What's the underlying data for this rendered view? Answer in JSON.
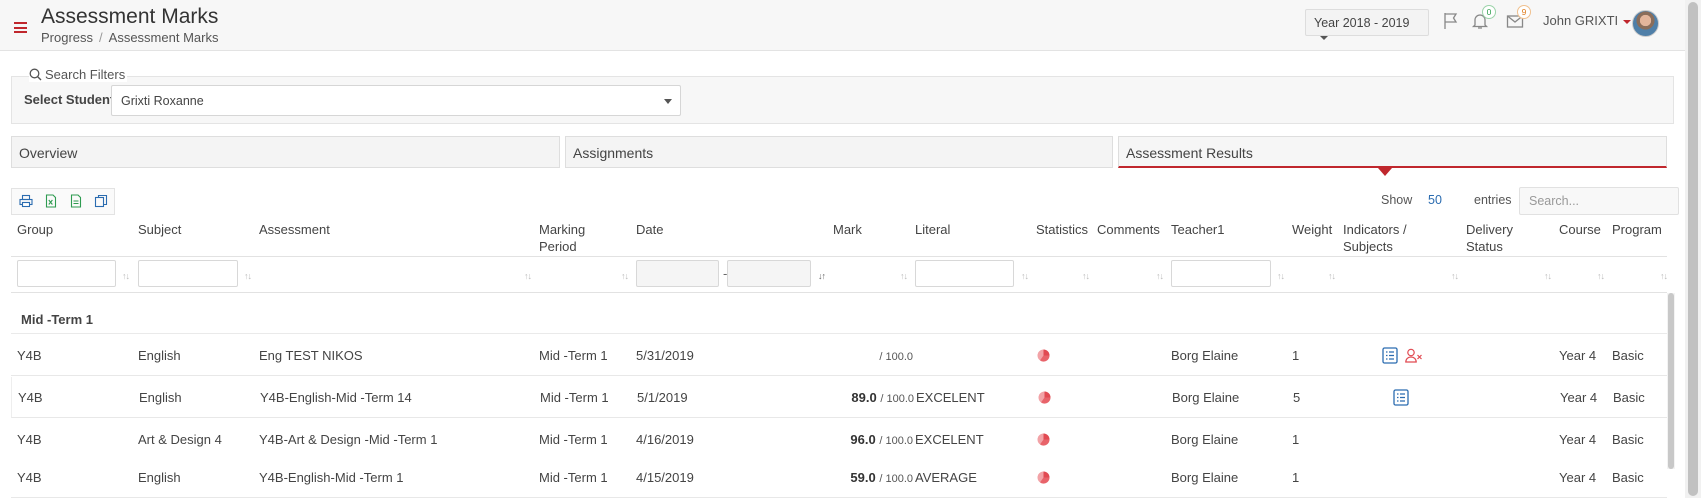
{
  "header": {
    "title": "Assessment Marks",
    "breadcrumb": [
      "Progress",
      "Assessment Marks"
    ],
    "year_selector": "Year 2018 - 2019",
    "notifications_count": "0",
    "messages_count": "9",
    "user_name": "John GRIXTI"
  },
  "filters": {
    "legend": "Search Filters",
    "student_label": "Select Student",
    "student_value": "Grixti Roxanne"
  },
  "tabs": [
    {
      "label": "Overview",
      "active": false
    },
    {
      "label": "Assignments",
      "active": false
    },
    {
      "label": "Assessment Results",
      "active": true
    }
  ],
  "table_controls": {
    "show_label": "Show",
    "show_value": "50",
    "entries_label": "entries",
    "search_placeholder": "Search..."
  },
  "columns": {
    "group": "Group",
    "subject": "Subject",
    "assessment": "Assessment",
    "marking_period_1": "Marking",
    "marking_period_2": "Period",
    "date": "Date",
    "mark": "Mark",
    "literal": "Literal",
    "statistics": "Statistics",
    "comments": "Comments",
    "teacher": "Teacher1",
    "weight": "Weight",
    "indicators_1": "Indicators /",
    "indicators_2": "Subjects",
    "delivery_1": "Delivery",
    "delivery_2": "Status",
    "course": "Course",
    "program": "Program"
  },
  "group_label": "Mid -Term 1",
  "rows": [
    {
      "group": "Y4B",
      "subject": "English",
      "assessment": "Eng TEST NIKOS",
      "period": "Mid -Term 1",
      "date": "5/31/2019",
      "mark": "",
      "max": "/ 100.0",
      "literal": "",
      "teacher": "Borg Elaine",
      "weight": "1",
      "course": "Year 4",
      "program": "Basic"
    },
    {
      "group": "Y4B",
      "subject": "English",
      "assessment": "Y4B-English-Mid -Term 14",
      "period": "Mid -Term 1",
      "date": "5/1/2019",
      "mark": "89.0",
      "max": "/ 100.0",
      "literal": "EXCELENT",
      "teacher": "Borg Elaine",
      "weight": "5",
      "course": "Year 4",
      "program": "Basic"
    },
    {
      "group": "Y4B",
      "subject": "Art & Design 4",
      "assessment": "Y4B-Art & Design -Mid -Term 1",
      "period": "Mid -Term 1",
      "date": "4/16/2019",
      "mark": "96.0",
      "max": "/ 100.0",
      "literal": "EXCELENT",
      "teacher": "Borg Elaine",
      "weight": "1",
      "course": "Year 4",
      "program": "Basic"
    },
    {
      "group": "Y4B",
      "subject": "English",
      "assessment": "Y4B-English-Mid -Term 1",
      "period": "Mid -Term 1",
      "date": "4/15/2019",
      "mark": "59.0",
      "max": "/ 100.0",
      "literal": "AVERAGE",
      "teacher": "Borg Elaine",
      "weight": "1",
      "course": "Year 4",
      "program": "Basic"
    }
  ],
  "colors": {
    "accent": "#c0272d",
    "link": "#2b6cb0",
    "stat_icon": "#e8636a"
  },
  "icons": [
    "menu-icon",
    "flag-icon",
    "bell-icon",
    "envelope-icon",
    "search-icon",
    "print-icon",
    "excel-icon",
    "csv-icon",
    "copy-icon",
    "pie-chart-icon",
    "indicator-list-icon",
    "user-remove-icon"
  ]
}
